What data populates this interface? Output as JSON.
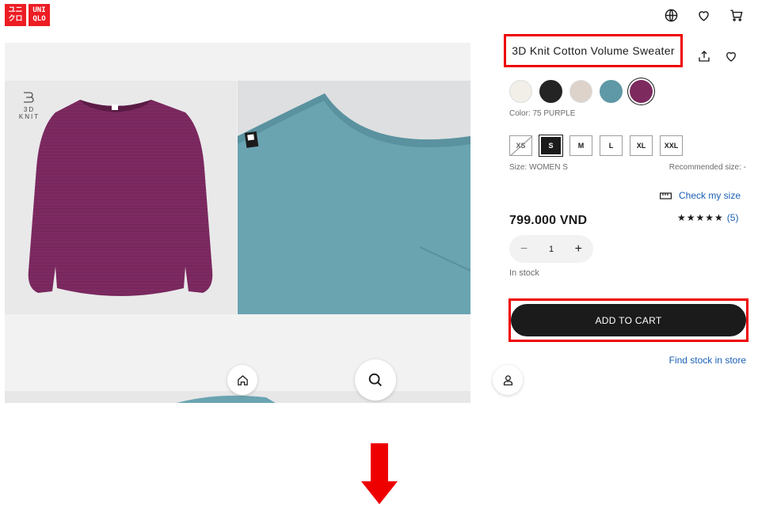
{
  "brand": {
    "logo_left": [
      "ユニ",
      "クロ"
    ],
    "logo_right": [
      "UNI",
      "QLO"
    ]
  },
  "gallery": {
    "badge_text": "3D KNIT"
  },
  "product": {
    "title": "3D Knit Cotton Volume Sweater",
    "colors": [
      {
        "name": "off-white",
        "hex": "#f2efe9"
      },
      {
        "name": "black",
        "hex": "#242424"
      },
      {
        "name": "beige",
        "hex": "#ddd3cb"
      },
      {
        "name": "blue",
        "hex": "#5f98a6"
      },
      {
        "name": "purple",
        "hex": "#7d2a5f",
        "selected": true
      }
    ],
    "color_label": "Color: 75 PURPLE",
    "sizes": [
      {
        "label": "XS",
        "state": "out-of-stock"
      },
      {
        "label": "S",
        "state": "selected"
      },
      {
        "label": "M",
        "state": "available"
      },
      {
        "label": "L",
        "state": "available"
      },
      {
        "label": "XL",
        "state": "available"
      },
      {
        "label": "XXL",
        "state": "available"
      }
    ],
    "size_label": "Size: WOMEN S",
    "recommended_size": "Recommended size: -",
    "check_size": "Check my size",
    "price": "799.000 VND",
    "rating": {
      "stars": "★★★★★",
      "count": "(5)",
      "value": 4.5
    },
    "quantity": "1",
    "stock_status": "In stock",
    "add_to_cart": "ADD TO CART",
    "find_stock": "Find stock in store"
  },
  "colors": {
    "accent_link": "#1a5fb4",
    "highlight_box": "#ee0000",
    "brand_red": "#ed1d24"
  },
  "icons": [
    "globe-icon",
    "heart-icon",
    "cart-icon",
    "share-icon",
    "home-icon",
    "search-icon",
    "user-icon",
    "ruler-icon",
    "plus-icon",
    "minus-icon",
    "down-arrow"
  ]
}
